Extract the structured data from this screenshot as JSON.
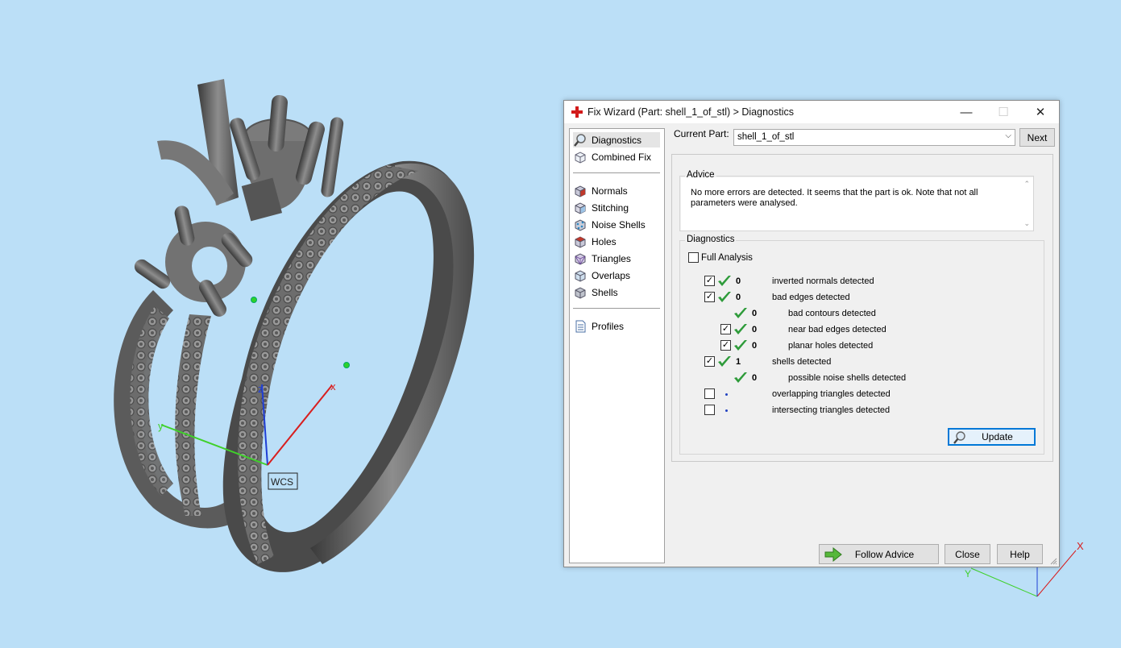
{
  "dialog": {
    "title": "Fix Wizard (Part: shell_1_of_stl) > Diagnostics",
    "window_buttons": {
      "minimize": "—",
      "maximize": "☐",
      "close": "✕"
    }
  },
  "nav": {
    "top_items": [
      {
        "label": "Diagnostics",
        "icon": "magnifier-icon",
        "selected": true
      },
      {
        "label": "Combined Fix",
        "icon": "cube-icon"
      }
    ],
    "fix_items": [
      {
        "label": "Normals",
        "icon": "normals-cube-icon",
        "accent": "#c0392b"
      },
      {
        "label": "Stitching",
        "icon": "stitching-cube-icon",
        "accent": "#2e86c1"
      },
      {
        "label": "Noise Shells",
        "icon": "noise-shells-icon",
        "accent": "#2e86c1"
      },
      {
        "label": "Holes",
        "icon": "holes-cube-icon",
        "accent": "#c0392b"
      },
      {
        "label": "Triangles",
        "icon": "triangles-cube-icon",
        "accent": "#8e44ad"
      },
      {
        "label": "Overlaps",
        "icon": "overlaps-cube-icon",
        "accent": "#5dade2"
      },
      {
        "label": "Shells",
        "icon": "shells-cube-icon",
        "accent": "#7f8c8d"
      }
    ],
    "bottom_items": [
      {
        "label": "Profiles",
        "icon": "profiles-document-icon"
      }
    ]
  },
  "current_part": {
    "label": "Current Part:",
    "value": "shell_1_of_stl",
    "next_label": "Next"
  },
  "advice": {
    "title": "Advice",
    "text": "No more errors are detected. It seems that the part is ok. Note that not all parameters were analysed."
  },
  "diagnostics": {
    "title": "Diagnostics",
    "full_analysis_label": "Full Analysis",
    "full_analysis_checked": false,
    "rows": [
      {
        "checkbox": true,
        "checked": true,
        "status": "ok",
        "value": "0",
        "label": "inverted normals detected",
        "indent": 0
      },
      {
        "checkbox": true,
        "checked": true,
        "status": "ok",
        "value": "0",
        "label": "bad edges detected",
        "indent": 0
      },
      {
        "checkbox": false,
        "checked": false,
        "status": "ok",
        "value": "0",
        "label": "bad contours detected",
        "indent": 1
      },
      {
        "checkbox": true,
        "checked": true,
        "status": "ok",
        "value": "0",
        "label": "near bad edges detected",
        "indent": 1
      },
      {
        "checkbox": true,
        "checked": true,
        "status": "ok",
        "value": "0",
        "label": "planar holes detected",
        "indent": 1
      },
      {
        "checkbox": true,
        "checked": true,
        "status": "ok",
        "value": "1",
        "label": "shells detected",
        "indent": 0
      },
      {
        "checkbox": false,
        "checked": false,
        "status": "ok",
        "value": "0",
        "label": "possible noise shells detected",
        "indent": 1
      },
      {
        "checkbox": true,
        "checked": false,
        "status": "not-analysed",
        "value": "",
        "label": "overlapping triangles detected",
        "indent": 0
      },
      {
        "checkbox": true,
        "checked": false,
        "status": "not-analysed",
        "value": "",
        "label": "intersecting triangles detected",
        "indent": 0
      }
    ],
    "update_label": "Update"
  },
  "footer": {
    "follow_advice_label": "Follow Advice",
    "close_label": "Close",
    "help_label": "Help"
  },
  "viewport": {
    "wcs_label": "WCS",
    "axis_labels": {
      "x": "x",
      "y": "y",
      "z": "z"
    },
    "axis_colors": {
      "x": "#d81e1e",
      "y": "#3fd12a",
      "z": "#1f3fd6"
    },
    "background": "#bbdff7"
  }
}
